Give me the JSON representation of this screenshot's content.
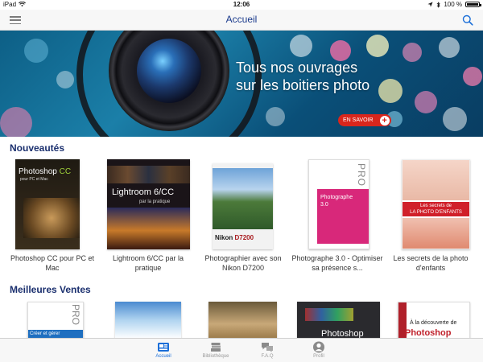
{
  "status_bar": {
    "device": "iPad",
    "time": "12:06",
    "battery": "100 %"
  },
  "nav": {
    "title": "Accueil",
    "menu_icon": "hamburger-icon",
    "search_icon": "search-icon"
  },
  "banner": {
    "line1": "Tous nos ouvrages",
    "line2": "sur les boitiers photo",
    "button_label": "EN SAVOIR",
    "button_icon": "plus-icon"
  },
  "sections": {
    "nouveautes": {
      "title": "Nouveautés",
      "books": [
        {
          "title": "Photoshop CC pour PC et Mac",
          "cover_heading": "Photoshop",
          "cover_heading_accent": "CC",
          "cover_sub": "pour PC et Mac"
        },
        {
          "title": "Lightroom 6/CC par la pratique",
          "cover_heading": "Lightroom 6/CC",
          "cover_sub": "par la pratique"
        },
        {
          "title": "Photographier avec son Nikon D7200",
          "cover_brand": "Nikon",
          "cover_model": "D7200"
        },
        {
          "title": "Photographe 3.0 - Optimiser sa présence s...",
          "cover_heading": "Photographe",
          "cover_sub": "3.0",
          "cover_pro": "PRO"
        },
        {
          "title": "Les secrets de la photo d'enfants",
          "cover_band": "LA PHOTO D'ENFANTS",
          "cover_band_top": "Les secrets de"
        }
      ]
    },
    "meilleures_ventes": {
      "title": "Meilleures Ventes",
      "books": [
        {
          "cover_pro": "PRO",
          "cover_text": "Créer et gérer"
        },
        {
          "cover_text": ""
        },
        {
          "cover_text": ""
        },
        {
          "cover_heading": "Photoshop"
        },
        {
          "cover_top": "À la découverte de",
          "cover_heading": "Photoshop"
        }
      ]
    }
  },
  "tabbar": {
    "tabs": [
      {
        "label": "Accueil",
        "icon": "home-icon",
        "active": true
      },
      {
        "label": "Bibliothèque",
        "icon": "books-icon",
        "active": false
      },
      {
        "label": "F.A.Q",
        "icon": "chat-icon",
        "active": false
      },
      {
        "label": "Profil",
        "icon": "profile-icon",
        "active": false
      }
    ]
  },
  "colors": {
    "accent": "#1a6ed8",
    "heading": "#1a2f6e",
    "nav_title": "#1a3a8c",
    "banner_button": "#d9261c"
  }
}
